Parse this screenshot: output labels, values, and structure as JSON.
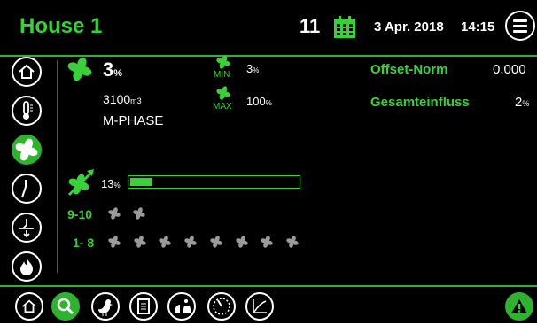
{
  "header": {
    "house_title": "House 1",
    "day": "11",
    "date": "3 Apr. 2018",
    "time": "14:15"
  },
  "ventilation": {
    "level_value": "3",
    "level_unit": "%",
    "airflow_value": "3100",
    "airflow_unit": "m3",
    "phase": "M-PHASE",
    "min_label": "MIN",
    "min_value": "3",
    "min_unit": "%",
    "max_label": "MAX",
    "max_value": "100",
    "max_unit": "%"
  },
  "settings": {
    "offset_label": "Offset-Norm",
    "offset_value": "0.000",
    "influence_label": "Gesamteinfluss",
    "influence_value": "2",
    "influence_unit": "%"
  },
  "progress": {
    "value": "13",
    "unit": "%",
    "fraction": 0.13
  },
  "fan_groups": {
    "group_a_label": "9-10",
    "group_b_label": "1- 8"
  },
  "colors": {
    "accent": "#3ad03a",
    "accent_dark": "#2fb32f",
    "background": "#000000",
    "fan_idle": "#9a9a9a"
  },
  "icons": {
    "calendar": "calendar-icon",
    "menu": "hamburger-menu-icon",
    "fan": "fan-icon",
    "warning": "warning-icon"
  }
}
